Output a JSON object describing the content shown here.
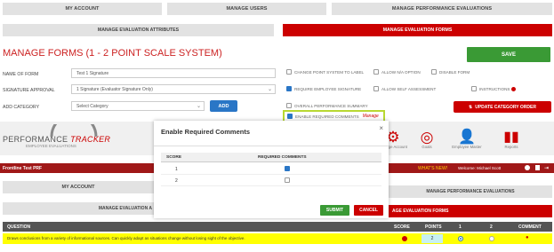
{
  "top_tabs": [
    "MY ACCOUNT",
    "MANAGE USERS",
    "MANAGE PERFORMANCE EVALUATIONS"
  ],
  "sub_tabs": [
    "MANAGE EVALUATION ATTRIBUTES",
    "MANAGE EVALUATION FORMS"
  ],
  "page_title": "MANAGE FORMS (1 - 2 POINT SCALE SYSTEM)",
  "save_label": "SAVE",
  "form": {
    "name_label": "NAME OF FORM",
    "name_value": "Test 1 Signature",
    "signature_label": "SIGNATURE APPROVAL",
    "signature_value": "1 Signature (Evaluator Signature Only)",
    "category_label": "ADD CATEGORY",
    "category_value": "Select Category",
    "add_label": "ADD"
  },
  "options": {
    "change_point": "CHANGE POINT SYSTEM TO LABEL",
    "allow_na": "ALLOW N/A OPTION",
    "disable_form": "DISABLE FORM",
    "require_sig": "REQUIRE EMPLOYEE SIGNATURE",
    "allow_self": "ALLOW SELF ASSESSMENT",
    "instructions": "INSTRUCTIONS",
    "overall": "OVERALL PERFORMANCE SUMMARY",
    "enable_req": "ENABLE REQUIRED COMMENTS",
    "manage": "Manage",
    "update_order": "UPDATE CATEGORY ORDER"
  },
  "bg": {
    "logo_main": "PERFORMANCE",
    "logo_accent": "TRACKER",
    "logo_sub": "EMPLOYEE EVALUATIONS",
    "company": "Frontline Test PRF",
    "whats_new": "WHAT'S NEW!",
    "welcome": "Welcome: Michael Scott",
    "icons": [
      "Manage Account",
      "Goals",
      "Employee Master",
      "Reports"
    ],
    "my_account": "MY ACCOUNT",
    "manage_perf": "MANAGE PERFORMANCE EVALUATIONS",
    "manage_eval_a": "MANAGE EVALUATION A",
    "manage_forms": "AGE EVALUATION FORMS"
  },
  "modal": {
    "title": "Enable Required Comments",
    "close": "×",
    "col_score": "SCORE",
    "col_req": "REQUIRED COMMENTS",
    "rows": [
      {
        "score": "1",
        "checked": true
      },
      {
        "score": "2",
        "checked": false
      }
    ],
    "submit": "SUBMIT",
    "cancel": "CANCEL"
  },
  "table": {
    "headers": [
      "QUESTION",
      "SCORE",
      "POINTS",
      "1",
      "2",
      "COMMENT"
    ],
    "row_text": "Draws conclusions from a variety of informational sources. Can quickly adapt as situations change without losing sight of the objective.",
    "points": "2"
  },
  "colors": {
    "red": "#cc0000",
    "green": "#3a9a35",
    "blue": "#2a76c6",
    "header_dark": "#555555",
    "yellow_row": "#ffff00"
  }
}
